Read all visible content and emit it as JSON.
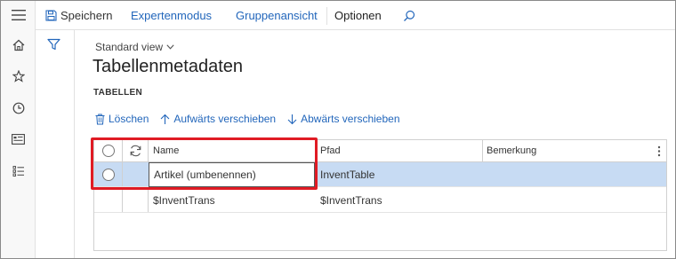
{
  "actionpane": {
    "save_label": "Speichern",
    "expert_label": "Expertenmodus",
    "group_label": "Gruppenansicht",
    "options_label": "Optionen"
  },
  "page": {
    "view_name": "Standard view",
    "title": "Tabellenmetadaten",
    "section": "TABELLEN"
  },
  "toolbar": {
    "delete_label": "Löschen",
    "move_up_label": "Aufwärts verschieben",
    "move_down_label": "Abwärts verschieben"
  },
  "grid": {
    "columns": [
      "Name",
      "Pfad",
      "Bemerkung"
    ],
    "rows": [
      {
        "name": "Artikel (umbenennen)",
        "path": "InventTable",
        "remark": "",
        "selected": true,
        "editing": true
      },
      {
        "name": "$InventTrans",
        "path": "$InventTrans",
        "remark": "",
        "selected": false,
        "editing": false
      }
    ]
  },
  "icons": {
    "rail": [
      "hamburger-icon",
      "home-icon",
      "star-icon",
      "clock-icon",
      "workspace-icon",
      "list-icon"
    ],
    "filter": "filter-icon",
    "search": "search-icon"
  },
  "colors": {
    "link": "#2266bb",
    "selection": "#c7dbf3",
    "highlight": "#e01b24"
  }
}
